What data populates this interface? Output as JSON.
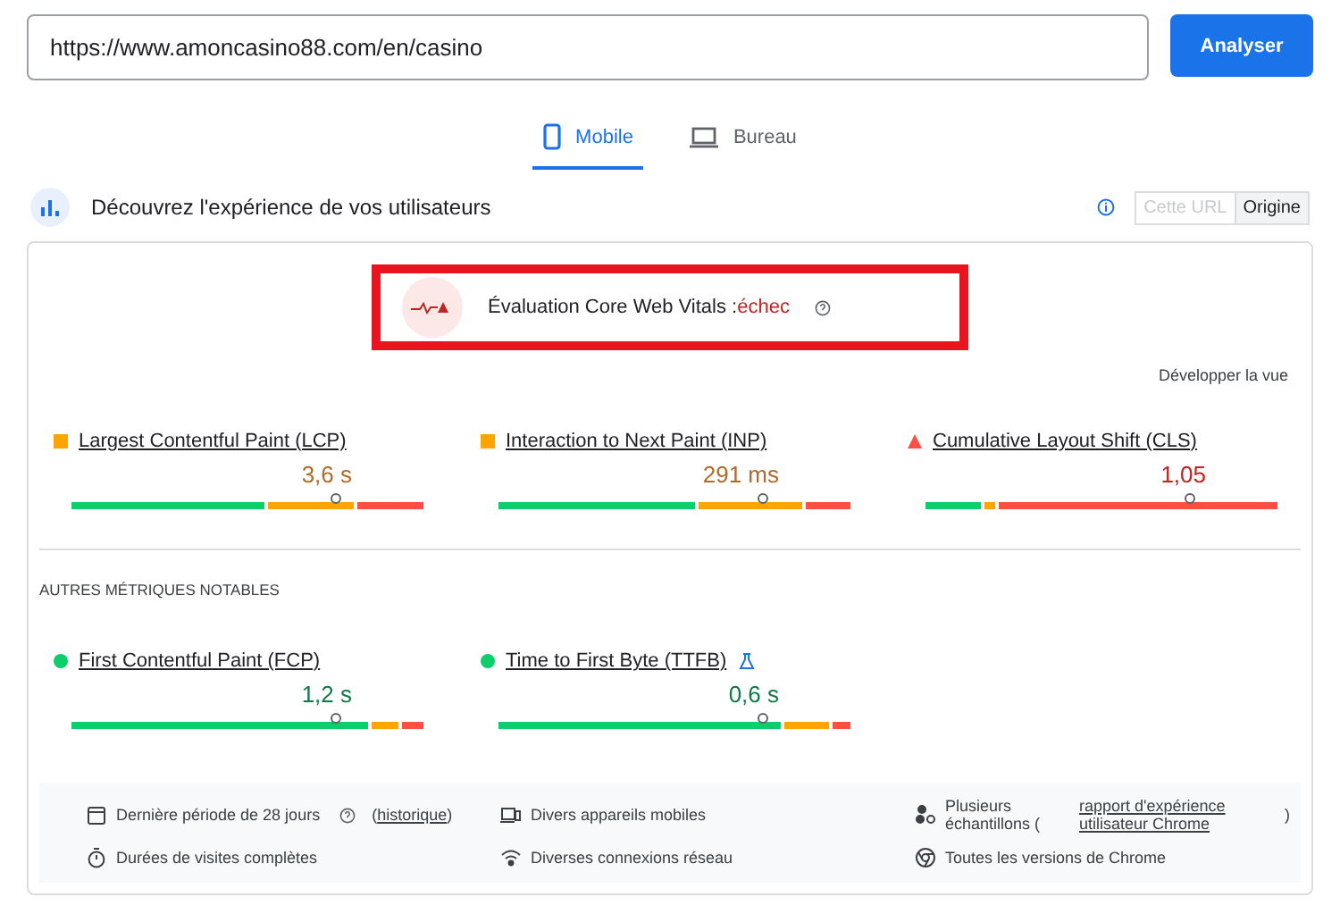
{
  "url_field": {
    "value": "https://www.amoncasino88.com/en/casino"
  },
  "analyze_button": "Analyser",
  "device_tabs": [
    {
      "label": "Mobile",
      "kind": "phone",
      "selected": true
    },
    {
      "label": "Bureau",
      "kind": "desktop",
      "selected": false
    }
  ],
  "section": {
    "title": "Découvrez l'expérience de vos utilisateurs",
    "scope_toggle": [
      {
        "label": "Cette URL",
        "selected": false,
        "disabled": true
      },
      {
        "label": "Origine",
        "selected": true,
        "disabled": false
      }
    ]
  },
  "assessment": {
    "label": "Évaluation Core Web Vitals :",
    "result": "échec",
    "kind": "poor"
  },
  "expand_link": "Développer la vue",
  "core_metrics": [
    {
      "name": "Largest Contentful Paint (LCP)",
      "value": "3,6 s",
      "kind": "average"
    },
    {
      "name": "Interaction to Next Paint (INP)",
      "value": "291 ms",
      "kind": "average"
    },
    {
      "name": "Cumulative Layout Shift (CLS)",
      "value": "1,05",
      "kind": "poor"
    }
  ],
  "other_heading": "AUTRES MÉTRIQUES NOTABLES",
  "other_metrics": [
    {
      "name": "First Contentful Paint (FCP)",
      "value": "1,2 s",
      "kind": "good",
      "experimental": false
    },
    {
      "name": "Time to First Byte (TTFB)",
      "value": "0,6 s",
      "kind": "good",
      "experimental": true
    }
  ],
  "footer": [
    {
      "kind": "calendar",
      "text": "Dernière période de 28 jours",
      "help": true,
      "link_open": "(",
      "link": "historique",
      "link_close": ")"
    },
    {
      "kind": "devices",
      "text": "Divers appareils mobiles"
    },
    {
      "kind": "samples",
      "text": "Plusieurs échantillons (",
      "link": "rapport d'expérience utilisateur Chrome",
      "link_close": ")"
    },
    {
      "kind": "timer",
      "text": "Durées de visites complètes"
    },
    {
      "kind": "wifi",
      "text": "Diverses connexions réseau"
    },
    {
      "kind": "chrome",
      "text": "Toutes les versions de Chrome"
    }
  ]
}
